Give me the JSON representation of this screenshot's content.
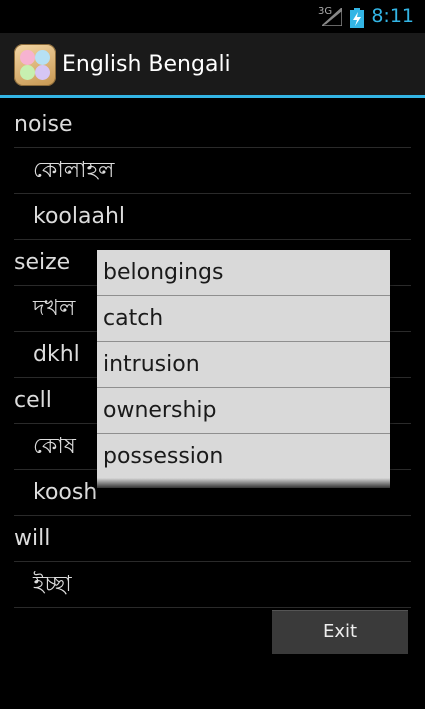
{
  "status_bar": {
    "network": "3G",
    "time": "8:11",
    "accent": "#33b5e5"
  },
  "action_bar": {
    "title": "English Bengali",
    "accent": "#33b5e5"
  },
  "list": {
    "items": [
      {
        "text": "noise",
        "level": "word"
      },
      {
        "text": "কোলাহল",
        "level": "translation"
      },
      {
        "text": "koolaahl",
        "level": "transliteration"
      },
      {
        "text": "seize",
        "level": "word"
      },
      {
        "text": "দখল",
        "level": "translation"
      },
      {
        "text": "dkhl",
        "level": "transliteration"
      },
      {
        "text": "cell",
        "level": "word"
      },
      {
        "text": "কোষ",
        "level": "translation"
      },
      {
        "text": "koosh",
        "level": "transliteration"
      },
      {
        "text": "will",
        "level": "word"
      },
      {
        "text": "ইচ্ছা",
        "level": "translation"
      }
    ]
  },
  "popup": {
    "items": [
      "belongings",
      "catch",
      "intrusion",
      "ownership",
      "possession"
    ]
  },
  "exit_button": {
    "label": "Exit"
  }
}
